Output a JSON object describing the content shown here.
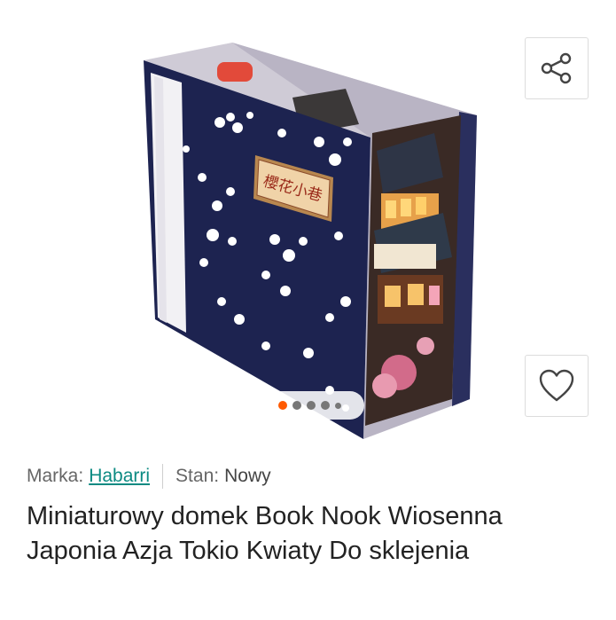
{
  "gallery": {
    "image_alt": "Book Nook",
    "sign_text": "櫻花小巷",
    "dots_count": 5,
    "active_index": 0
  },
  "actions": {
    "share_icon": "share-icon",
    "favorite_icon": "heart-icon"
  },
  "meta": {
    "brand_label": "Marka:",
    "brand_value": "Habarri",
    "condition_label": "Stan:",
    "condition_value": "Nowy"
  },
  "product": {
    "title": "Miniaturowy domek Book Nook Wiosenna Japonia Azja Tokio Kwiaty Do sklejenia"
  },
  "colors": {
    "accent": "#ff5a00",
    "link": "#0c8a82",
    "fabric": "#1d2350"
  }
}
